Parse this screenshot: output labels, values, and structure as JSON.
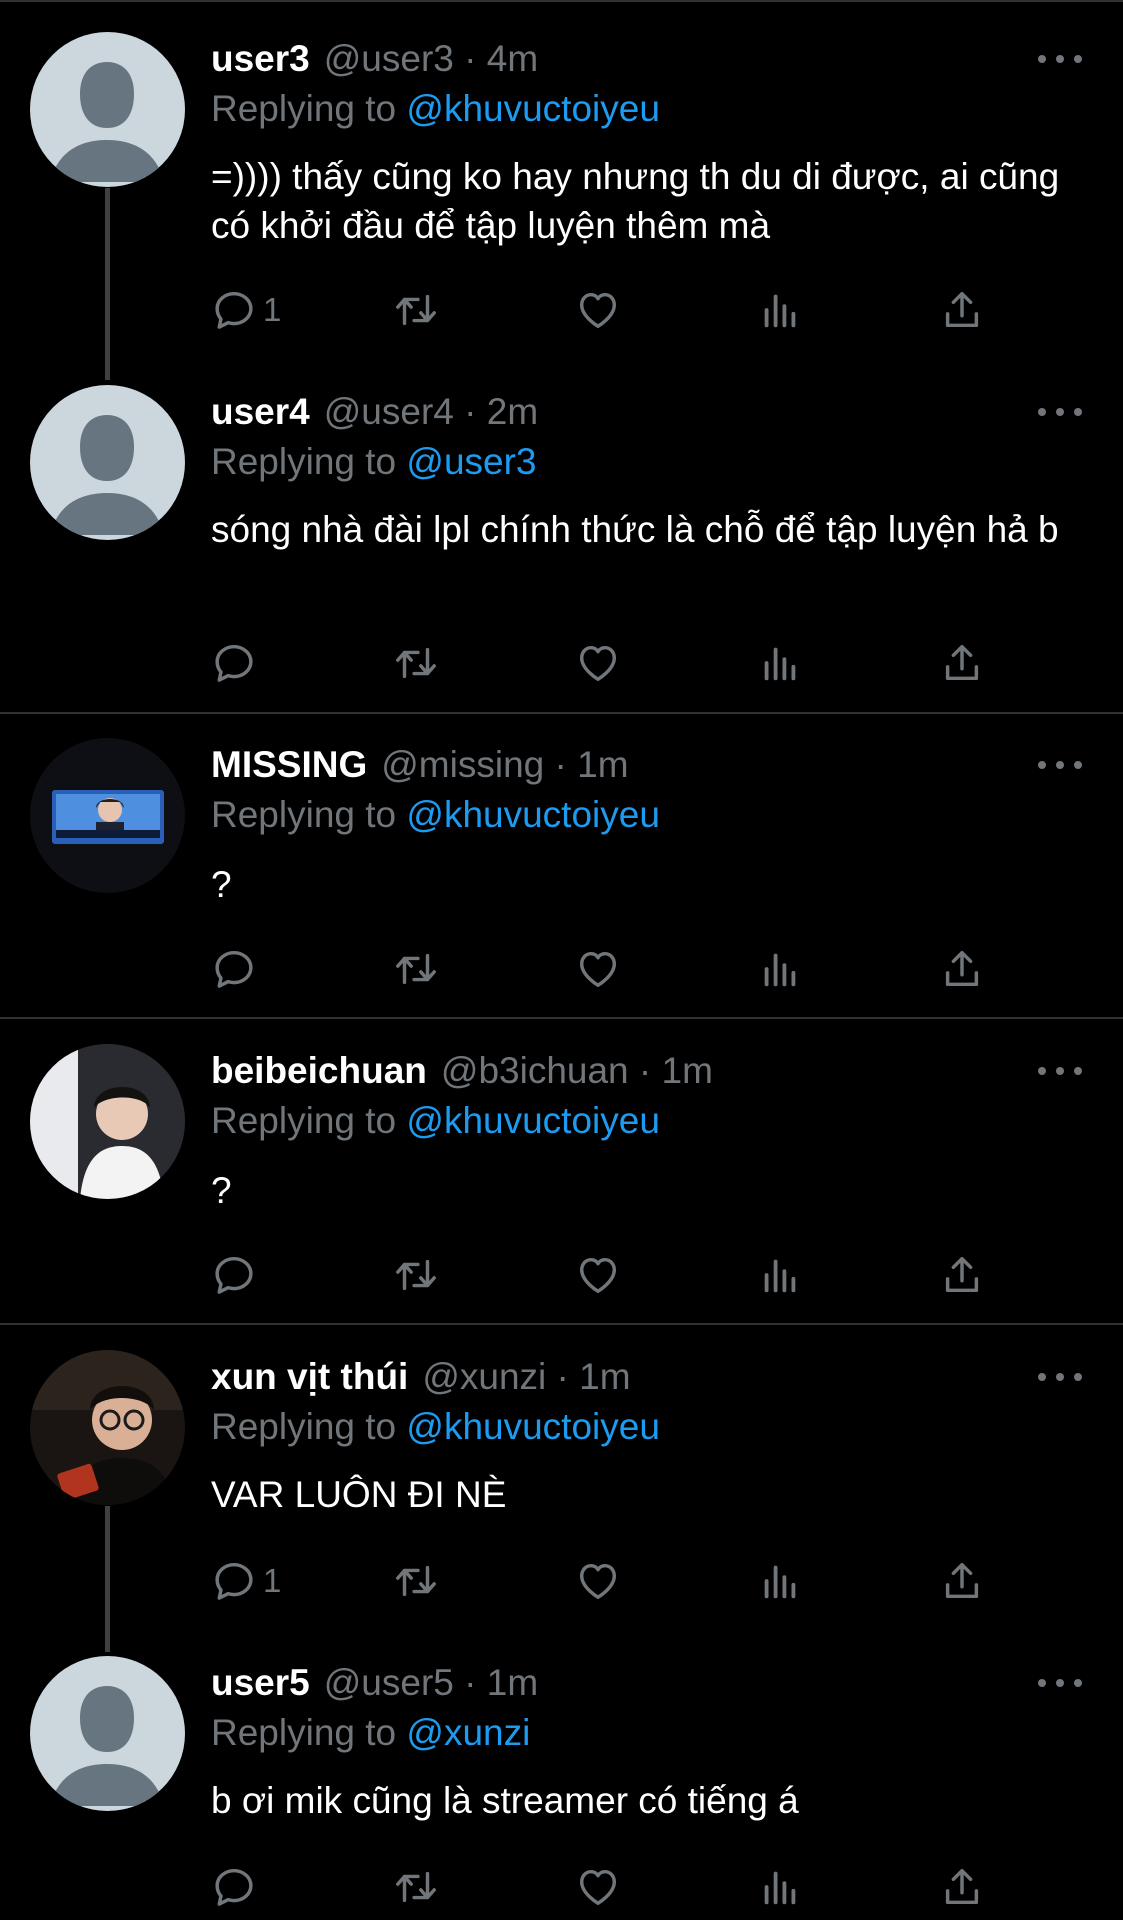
{
  "colors": {
    "background": "#000000",
    "text": "#ffffff",
    "muted": "#71767b",
    "mention": "#1d9bf0",
    "divider": "#2f3336"
  },
  "reply_prefix": "Replying to",
  "tweets": [
    {
      "name": "user3",
      "handle": "@user3",
      "time": "· 4m",
      "replying_to": "@khuvuctoiyeu",
      "text": "=)))) thấy cũng ko hay nhưng th du di được, ai cũng có khởi đầu để tập luyện thêm mà",
      "reply_count": "1",
      "avatar": "default-avatar"
    },
    {
      "name": "user4",
      "handle": "@user4",
      "time": "· 2m",
      "replying_to": "@user3",
      "text": "sóng nhà đài lpl chính thức là chỗ để tập luyện hả b",
      "reply_count": "",
      "avatar": "default-avatar"
    },
    {
      "name": "MISSING",
      "handle": "@missing",
      "time": "· 1m",
      "replying_to": "@khuvuctoiyeu",
      "text": "?",
      "reply_count": "",
      "avatar": "photo-tv-screen"
    },
    {
      "name": "beibeichuan",
      "handle": "@b3ichuan",
      "time": "· 1m",
      "replying_to": "@khuvuctoiyeu",
      "text": "?",
      "reply_count": "",
      "avatar": "photo-boy-white-shirt"
    },
    {
      "name": "xun vịt thúi",
      "handle": "@xunzi",
      "time": "· 1m",
      "replying_to": "@khuvuctoiyeu",
      "text": "VAR LUÔN ĐI NÈ",
      "reply_count": "1",
      "avatar": "photo-boy-glasses"
    },
    {
      "name": "user5",
      "handle": "@user5",
      "time": "· 1m",
      "replying_to": "@xunzi",
      "text": "b ơi mik cũng là streamer có tiếng á",
      "reply_count": "",
      "avatar": "default-avatar"
    }
  ],
  "action_icons": [
    "reply-icon",
    "retweet-icon",
    "like-icon",
    "views-icon",
    "share-icon"
  ]
}
